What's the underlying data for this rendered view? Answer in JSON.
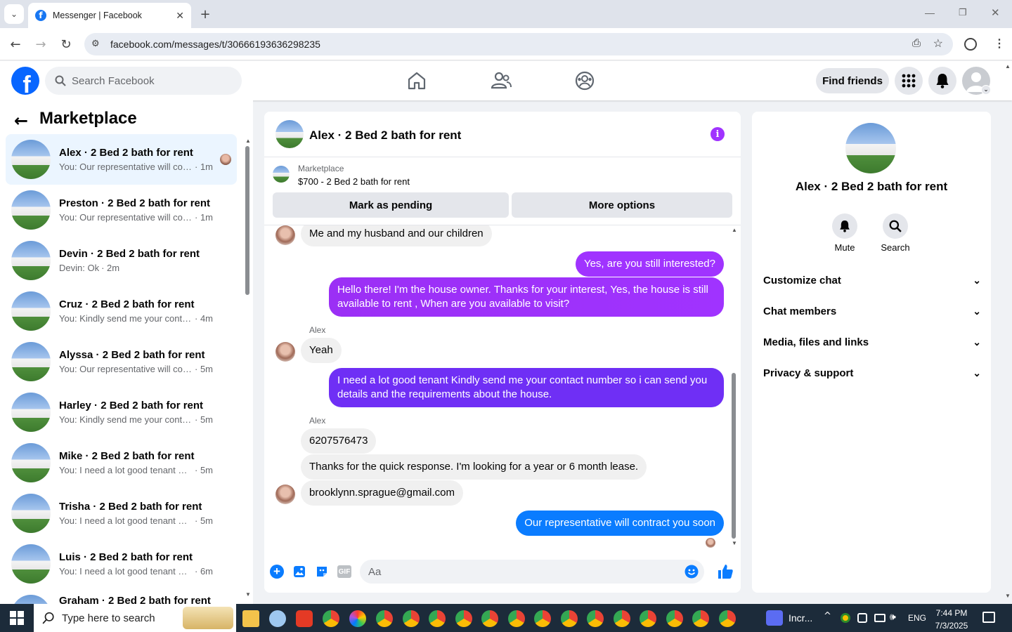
{
  "browser": {
    "tab_title": "Messenger | Facebook",
    "url": "facebook.com/messages/t/30666193636298235"
  },
  "header": {
    "search_placeholder": "Search Facebook",
    "find_friends": "Find friends"
  },
  "sidebar": {
    "title": "Marketplace",
    "conversations": [
      {
        "name": "Alex · 2 Bed 2 bath for rent",
        "preview": "You: Our representative will con...",
        "time": "· 1m",
        "active": true
      },
      {
        "name": "Preston · 2 Bed 2 bath for rent",
        "preview": "You: Our representative will contra...",
        "time": "· 1m"
      },
      {
        "name": "Devin · 2 Bed 2 bath for rent",
        "preview": "Devin: Ok",
        "time": "· 2m"
      },
      {
        "name": "Cruz · 2 Bed 2 bath for rent",
        "preview": "You: Kindly send me your contact ...",
        "time": "· 4m"
      },
      {
        "name": "Alyssa · 2 Bed 2 bath for rent",
        "preview": "You: Our representative will contra...",
        "time": "· 5m"
      },
      {
        "name": "Harley · 2 Bed 2 bath for rent",
        "preview": "You: Kindly send me your contact ...",
        "time": "· 5m"
      },
      {
        "name": "Mike · 2 Bed 2 bath for rent",
        "preview": "You: I need a lot good tenant Kindl...",
        "time": "· 5m"
      },
      {
        "name": "Trisha · 2 Bed 2 bath for rent",
        "preview": "You: I need a lot good tenant Kindl...",
        "time": "· 5m"
      },
      {
        "name": "Luis · 2 Bed 2 bath for rent",
        "preview": "You: I need a lot good tenant Kindl...",
        "time": "· 6m"
      },
      {
        "name": "Graham · 2 Bed 2 bath for rent",
        "preview": "",
        "time": ""
      }
    ]
  },
  "chat": {
    "title": "Alex · 2 Bed 2 bath for rent",
    "listing_label": "Marketplace",
    "listing_text": "$700 - 2 Bed 2 bath for rent",
    "mark_pending": "Mark as pending",
    "more_options": "More options",
    "messages": [
      {
        "dir": "in",
        "text": "Me and my husband and our children"
      },
      {
        "dir": "out",
        "text": "Yes, are you still interested?"
      },
      {
        "dir": "out",
        "text": "Hello there! I'm the house owner. Thanks for your interest, Yes, the house is still available to rent , When are you available to visit?"
      },
      {
        "dir": "in",
        "sender": "Alex",
        "text": "Yeah"
      },
      {
        "dir": "out",
        "text": "I need a lot good tenant Kindly send me your contact number so i can send you details and the requirements about the house."
      },
      {
        "dir": "in",
        "sender": "Alex",
        "text": "6207576473"
      },
      {
        "dir": "in",
        "text": "Thanks for the quick response. I'm looking for a year or 6 month lease."
      },
      {
        "dir": "in",
        "text": "brooklynn.sprague@gmail.com"
      },
      {
        "dir": "out",
        "text": "Our representative will contract you soon"
      }
    ],
    "composer_placeholder": "Aa"
  },
  "details": {
    "name": "Alex · 2 Bed 2 bath for rent",
    "mute": "Mute",
    "search": "Search",
    "sections": [
      "Customize chat",
      "Chat members",
      "Media, files and links",
      "Privacy & support"
    ]
  },
  "taskbar": {
    "search_placeholder": "Type here to search",
    "app_label": "Incr...",
    "lang": "ENG",
    "time": "7:44 PM",
    "date": "7/3/2025"
  },
  "colors": {
    "fb_blue": "#0866ff",
    "purple": "#a033ff",
    "violet": "#7b2ff7",
    "blue": "#0a7cff",
    "accent": "#a033ff"
  }
}
